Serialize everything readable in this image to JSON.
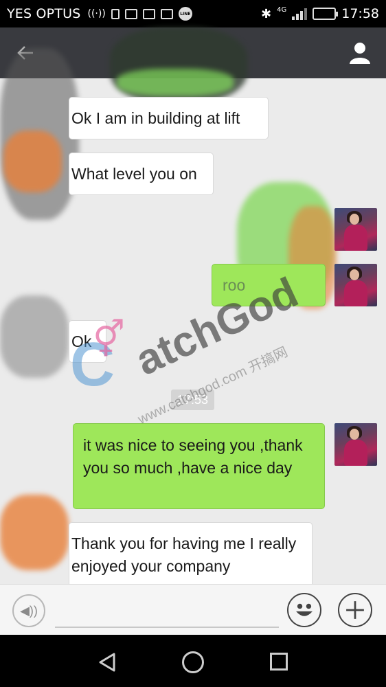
{
  "status_bar": {
    "carrier": "YES OPTUS",
    "network": "4G",
    "time": "17:58",
    "line_badge": "LINE"
  },
  "header": {
    "back_icon": "arrow-left-icon",
    "profile_icon": "person-icon"
  },
  "messages": [
    {
      "side": "left",
      "text": "Ok I am in building at lift"
    },
    {
      "side": "left",
      "text": "What level you on"
    },
    {
      "side": "right",
      "text": "roo"
    },
    {
      "side": "left",
      "text": "Ok"
    },
    {
      "side": "right",
      "text": "it was nice to seeing you ,thank you so much ,have a nice day"
    },
    {
      "side": "left",
      "text": "Thank you for having me I really enjoyed your company"
    }
  ],
  "timestamp": "17:53",
  "watermark": {
    "brand": "atchGod",
    "logo_letter": "C",
    "url": "www.catchgod.com 开搞网"
  },
  "input_bar": {
    "voice_icon": "voice-icon",
    "emoji_icon": "emoji-icon",
    "plus_icon": "plus-icon"
  },
  "colors": {
    "header_bg": "#393a3f",
    "sent_bubble": "#9ee75a",
    "received_bubble": "#ffffff",
    "chat_bg": "#ebebeb"
  }
}
